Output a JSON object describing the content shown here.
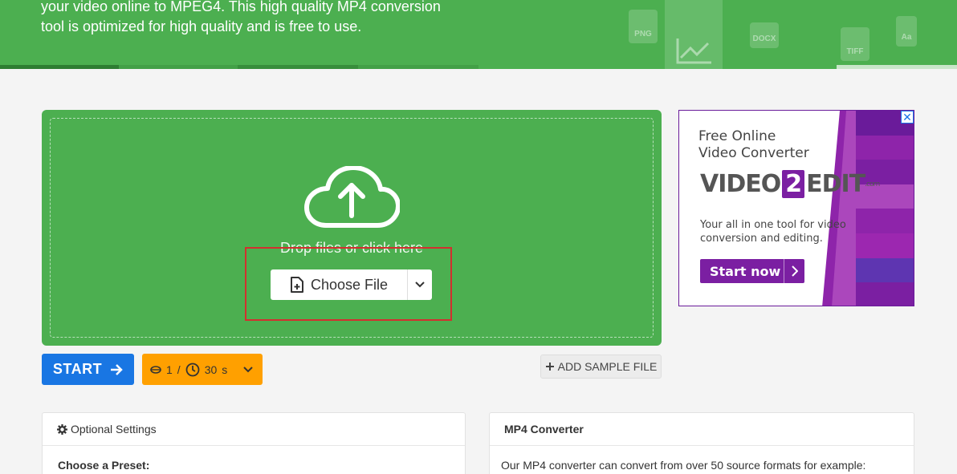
{
  "hero": {
    "lines": [
      "your video online to MPEG4. This high quality MP4 conversion",
      "tool is optimized for high quality and is free to use."
    ],
    "file_icons": [
      "PNG",
      "DOCX",
      "TIFF",
      "Aa"
    ]
  },
  "upload": {
    "drop_label": "Drop files or click here",
    "choose_label": "Choose File"
  },
  "actions": {
    "start_label": "START",
    "credits_count": "1",
    "credits_sep": "/",
    "time_value": "30",
    "time_unit": "s",
    "sample_label": "ADD SAMPLE FILE"
  },
  "ad": {
    "title_lines": [
      "Free Online",
      "Video Converter"
    ],
    "logo_left": "VIDEO",
    "logo_mid": "2",
    "logo_right": "EDIT",
    "logo_suffix": ".com",
    "desc_lines": [
      "Your all in one tool for video",
      "conversion and editing."
    ],
    "cta": "Start now",
    "close": "✕"
  },
  "panels": {
    "left_title": "Optional Settings",
    "left_body": "Choose a Preset:",
    "right_title": "MP4 Converter",
    "right_body": "Our MP4 converter can convert from over 50 source formats for example:"
  },
  "colors": {
    "green": "#4caf50",
    "blue": "#1976e3",
    "orange": "#ffa000",
    "purple": "#7b1fa2",
    "highlight": "#d32f2f"
  }
}
